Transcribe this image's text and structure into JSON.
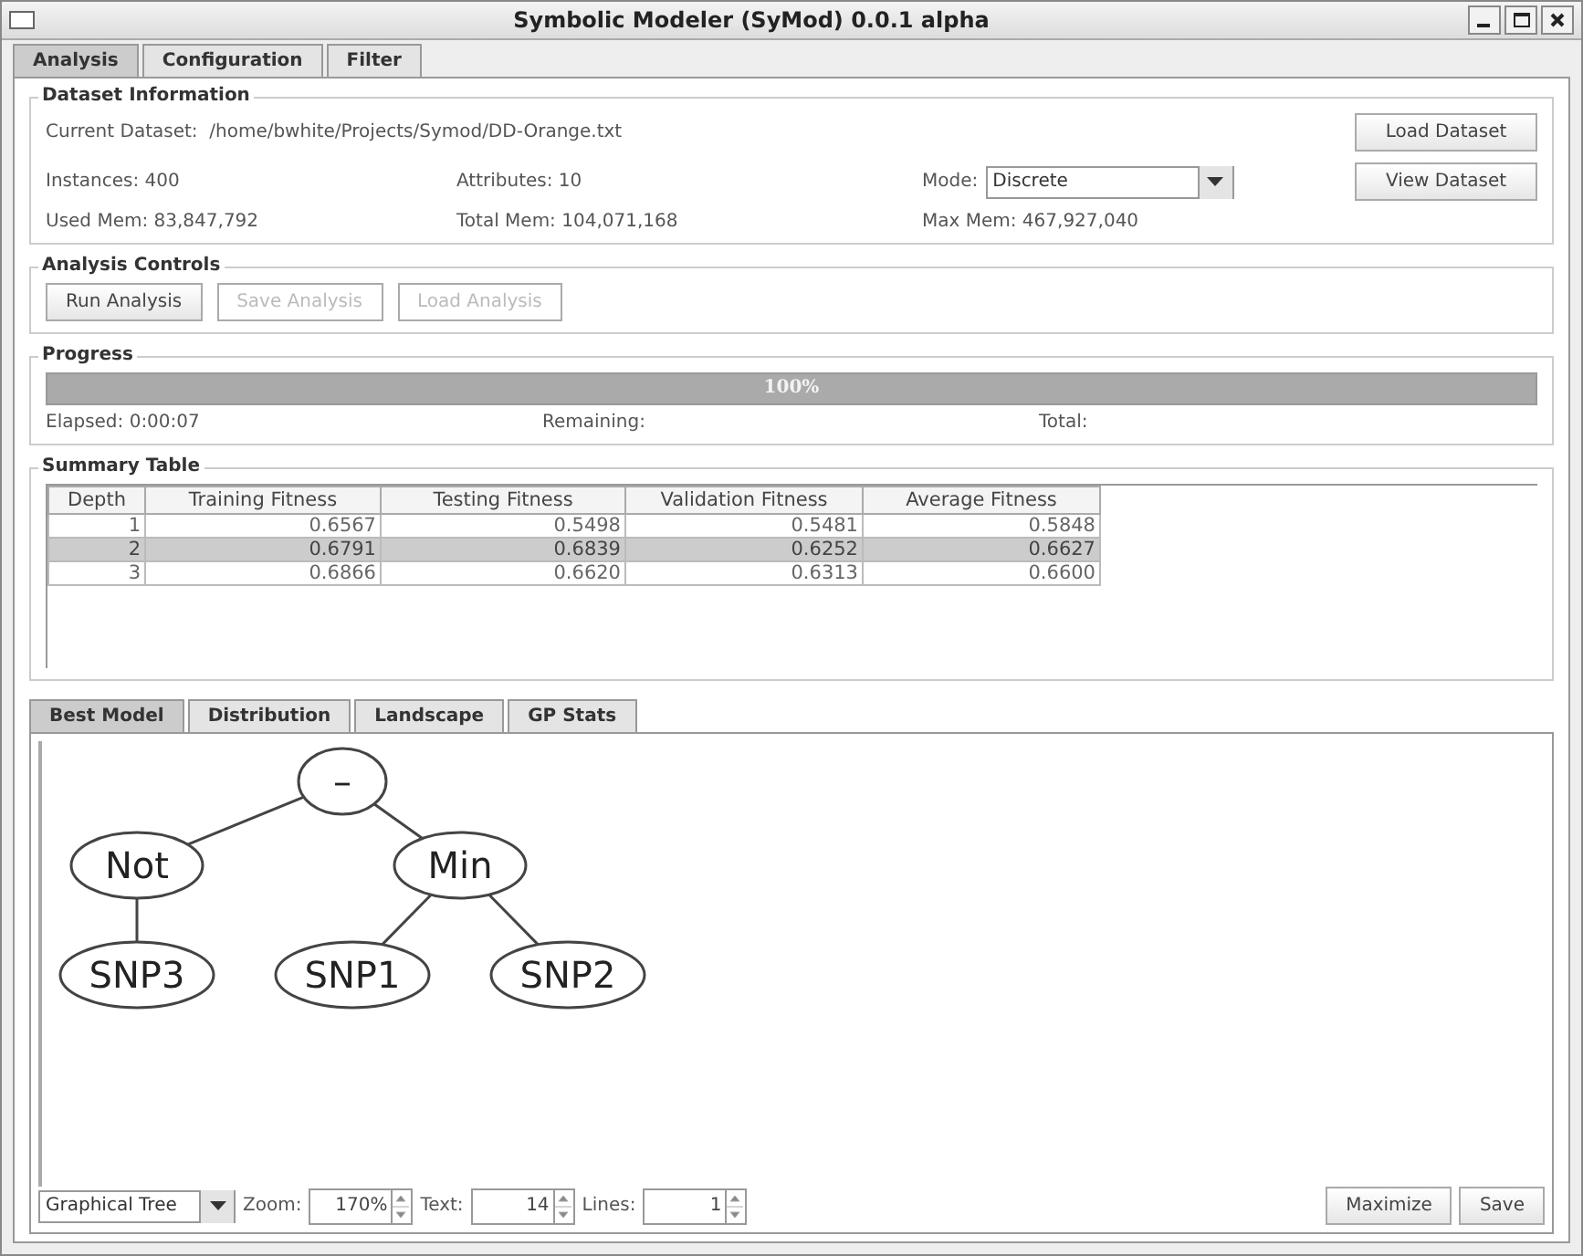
{
  "window": {
    "title": "Symbolic Modeler (SyMod) 0.0.1 alpha"
  },
  "tabs": [
    {
      "label": "Analysis",
      "selected": true
    },
    {
      "label": "Configuration",
      "selected": false
    },
    {
      "label": "Filter",
      "selected": false
    }
  ],
  "dataset_information": {
    "title": "Dataset Information",
    "current_dataset": "Current Dataset:  /home/bwhite/Projects/Symod/DD-Orange.txt",
    "instances": "Instances: 400",
    "attributes": "Attributes: 10",
    "mode_label": "Mode:",
    "mode_value": "Discrete",
    "used_mem": "Used Mem: 83,847,792",
    "total_mem": "Total Mem: 104,071,168",
    "max_mem": "Max Mem: 467,927,040",
    "buttons": [
      "Load Dataset",
      "View Dataset"
    ]
  },
  "analysis_controls": {
    "title": "Analysis Controls",
    "buttons": [
      {
        "label": "Run Analysis",
        "disabled": false
      },
      {
        "label": "Save Analysis",
        "disabled": true
      },
      {
        "label": "Load Analysis",
        "disabled": true
      }
    ]
  },
  "progress": {
    "title": "Progress",
    "level": 1,
    "text": "100%",
    "elapsed": "Elapsed: 0:00:07",
    "remaining": "Remaining:",
    "total": "Total:"
  },
  "summary_table": {
    "title": "Summary Table",
    "columns": [
      "Depth",
      "Training Fitness",
      "Testing Fitness",
      "Validation Fitness",
      "Average Fitness"
    ],
    "rows": [
      {
        "cells": [
          "1",
          "0.6567",
          "0.5498",
          "0.5481",
          "0.5848"
        ],
        "selected": false
      },
      {
        "cells": [
          "2",
          "0.6791",
          "0.6839",
          "0.6252",
          "0.6627"
        ],
        "selected": true
      },
      {
        "cells": [
          "3",
          "0.6866",
          "0.6620",
          "0.6313",
          "0.6600"
        ],
        "selected": false
      }
    ]
  },
  "model_tabs": [
    {
      "label": "Best Model",
      "selected": true
    },
    {
      "label": "Distribution",
      "selected": false
    },
    {
      "label": "Landscape",
      "selected": false
    },
    {
      "label": "GP Stats",
      "selected": false
    }
  ],
  "tree": {
    "label": "–",
    "children": [
      {
        "label": "Not",
        "children": [
          {
            "label": "SNP3"
          }
        ]
      },
      {
        "label": "Min",
        "children": [
          {
            "label": "SNP1"
          },
          {
            "label": "SNP2"
          }
        ]
      }
    ]
  },
  "bottom_bar": {
    "view": "Graphical Tree",
    "zoom_label": "Zoom:",
    "zoom_value": "170%",
    "text_label": "Text:",
    "text_value": "14",
    "lines_label": "Lines:",
    "lines_value": "1",
    "buttons": [
      "Maximize",
      "Save"
    ]
  }
}
